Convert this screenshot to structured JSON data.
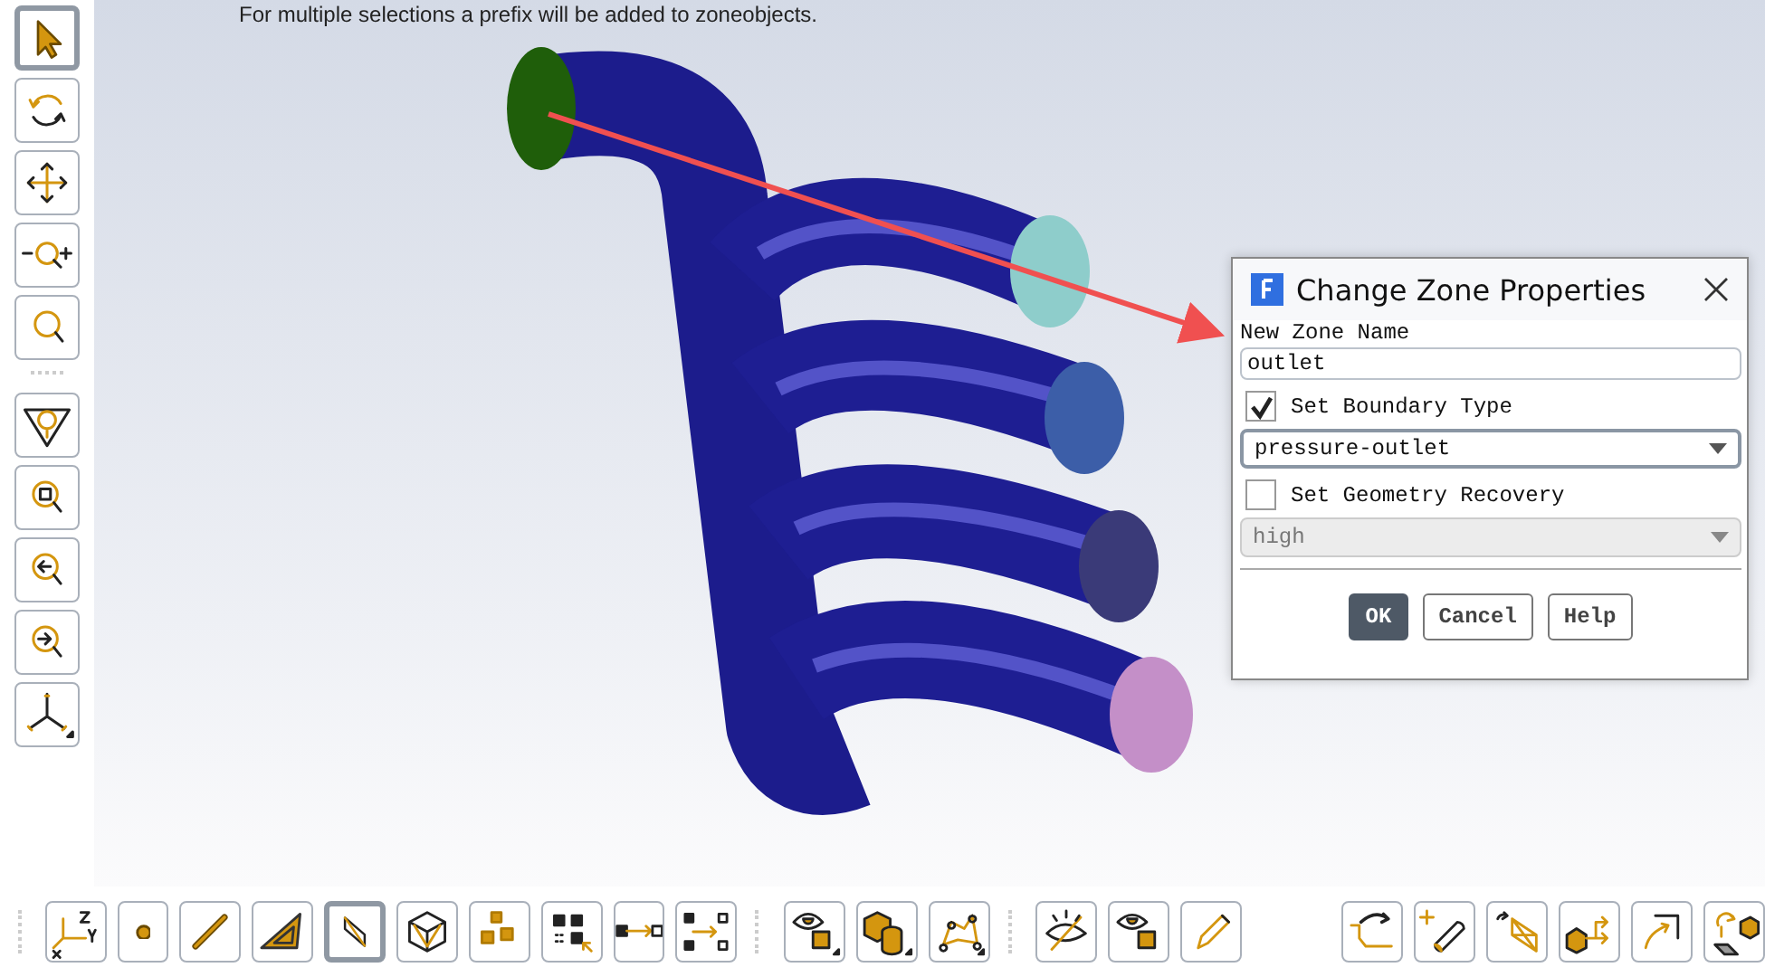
{
  "viewport": {
    "hint": "For multiple selections a prefix will be added to zoneobjects."
  },
  "left_toolbar": [
    {
      "selected": true
    },
    {
      "selected": false
    },
    {
      "selected": false
    },
    {
      "selected": false
    },
    {
      "selected": false
    },
    {
      "selected": false
    },
    {
      "selected": false
    },
    {
      "selected": false
    },
    {
      "selected": false
    },
    {
      "selected": false
    }
  ],
  "bottom_toolbar": [
    [
      {
        "selected": false
      },
      {
        "selected": false
      },
      {
        "selected": false
      },
      {
        "selected": false
      },
      {
        "selected": true
      },
      {
        "selected": false
      },
      {
        "selected": false
      },
      {
        "selected": false
      },
      {
        "selected": false
      },
      {
        "selected": false
      }
    ],
    [
      {
        "selected": false
      },
      {
        "selected": false
      },
      {
        "selected": false
      }
    ],
    [
      {
        "selected": false
      },
      {
        "selected": false
      },
      {
        "selected": false
      }
    ],
    [
      {
        "selected": false
      },
      {
        "selected": false
      },
      {
        "selected": false
      },
      {
        "selected": false
      },
      {
        "selected": false
      },
      {
        "selected": false
      }
    ]
  ],
  "dialog": {
    "title": "Change Zone Properties",
    "name_label": "New Zone Name",
    "name_value": "outlet",
    "boundary": {
      "label": "Set Boundary Type",
      "checked": true
    },
    "boundary_value": "pressure-outlet",
    "geometry": {
      "label": "Set Geometry Recovery",
      "checked": false
    },
    "geometry_value": "high",
    "buttons": [
      {
        "label": "OK",
        "default": true
      },
      {
        "label": "Cancel",
        "default": false
      },
      {
        "label": "Help",
        "default": false
      }
    ]
  }
}
